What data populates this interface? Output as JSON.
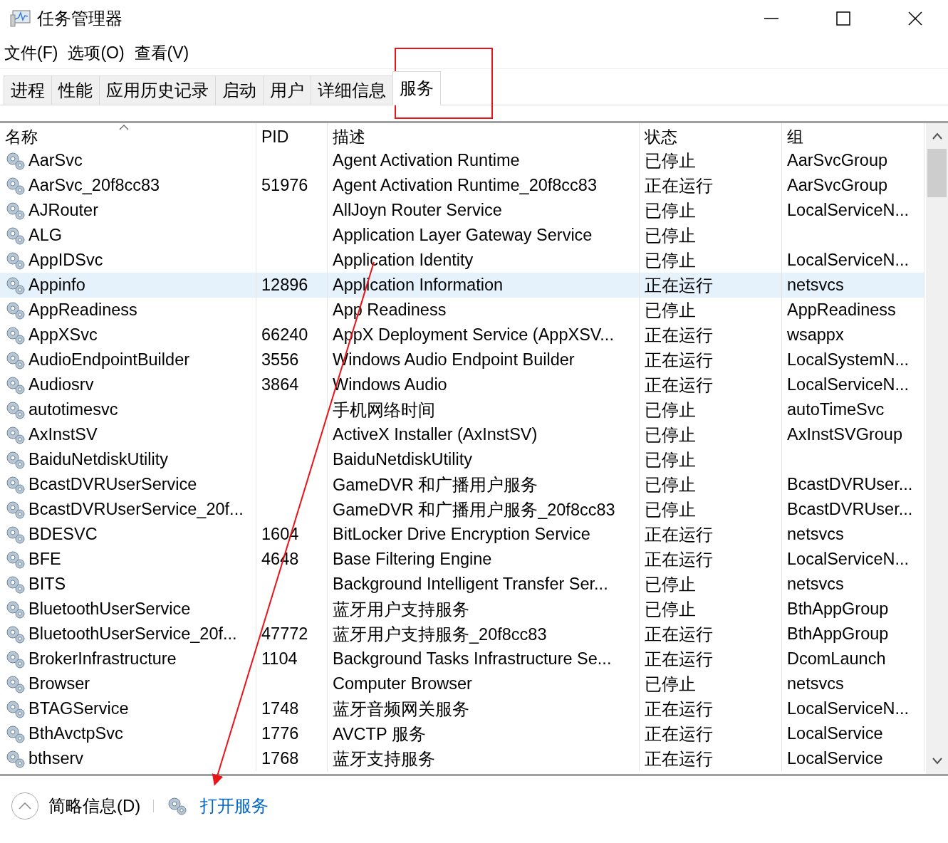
{
  "window": {
    "title": "任务管理器"
  },
  "menu": [
    "文件(F)",
    "选项(O)",
    "查看(V)"
  ],
  "tabs": [
    {
      "label": "进程",
      "selected": false
    },
    {
      "label": "性能",
      "selected": false
    },
    {
      "label": "应用历史记录",
      "selected": false
    },
    {
      "label": "启动",
      "selected": false
    },
    {
      "label": "用户",
      "selected": false
    },
    {
      "label": "详细信息",
      "selected": false
    },
    {
      "label": "服务",
      "selected": true
    }
  ],
  "table": {
    "columns": [
      {
        "label": "名称",
        "sorted": true
      },
      {
        "label": "PID",
        "sorted": false
      },
      {
        "label": "描述",
        "sorted": false
      },
      {
        "label": "状态",
        "sorted": false
      },
      {
        "label": "组",
        "sorted": false
      }
    ],
    "rows": [
      {
        "name": "AarSvc",
        "pid": "",
        "description": "Agent Activation Runtime",
        "status": "已停止",
        "group": "AarSvcGroup",
        "selected": false
      },
      {
        "name": "AarSvc_20f8cc83",
        "pid": "51976",
        "description": "Agent Activation Runtime_20f8cc83",
        "status": "正在运行",
        "group": "AarSvcGroup",
        "selected": false
      },
      {
        "name": "AJRouter",
        "pid": "",
        "description": "AllJoyn Router Service",
        "status": "已停止",
        "group": "LocalServiceN...",
        "selected": false
      },
      {
        "name": "ALG",
        "pid": "",
        "description": "Application Layer Gateway Service",
        "status": "已停止",
        "group": "",
        "selected": false
      },
      {
        "name": "AppIDSvc",
        "pid": "",
        "description": "Application Identity",
        "status": "已停止",
        "group": "LocalServiceN...",
        "selected": false
      },
      {
        "name": "Appinfo",
        "pid": "12896",
        "description": "Application Information",
        "status": "正在运行",
        "group": "netsvcs",
        "selected": true
      },
      {
        "name": "AppReadiness",
        "pid": "",
        "description": "App Readiness",
        "status": "已停止",
        "group": "AppReadiness",
        "selected": false
      },
      {
        "name": "AppXSvc",
        "pid": "66240",
        "description": "AppX Deployment Service (AppXSV...",
        "status": "正在运行",
        "group": "wsappx",
        "selected": false
      },
      {
        "name": "AudioEndpointBuilder",
        "pid": "3556",
        "description": "Windows Audio Endpoint Builder",
        "status": "正在运行",
        "group": "LocalSystemN...",
        "selected": false
      },
      {
        "name": "Audiosrv",
        "pid": "3864",
        "description": "Windows Audio",
        "status": "正在运行",
        "group": "LocalServiceN...",
        "selected": false
      },
      {
        "name": "autotimesvc",
        "pid": "",
        "description": "手机网络时间",
        "status": "已停止",
        "group": "autoTimeSvc",
        "selected": false
      },
      {
        "name": "AxInstSV",
        "pid": "",
        "description": "ActiveX Installer (AxInstSV)",
        "status": "已停止",
        "group": "AxInstSVGroup",
        "selected": false
      },
      {
        "name": "BaiduNetdiskUtility",
        "pid": "",
        "description": "BaiduNetdiskUtility",
        "status": "已停止",
        "group": "",
        "selected": false
      },
      {
        "name": "BcastDVRUserService",
        "pid": "",
        "description": "GameDVR 和广播用户服务",
        "status": "已停止",
        "group": "BcastDVRUser...",
        "selected": false
      },
      {
        "name": "BcastDVRUserService_20f...",
        "pid": "",
        "description": "GameDVR 和广播用户服务_20f8cc83",
        "status": "已停止",
        "group": "BcastDVRUser...",
        "selected": false
      },
      {
        "name": "BDESVC",
        "pid": "1604",
        "description": "BitLocker Drive Encryption Service",
        "status": "正在运行",
        "group": "netsvcs",
        "selected": false
      },
      {
        "name": "BFE",
        "pid": "4648",
        "description": "Base Filtering Engine",
        "status": "正在运行",
        "group": "LocalServiceN...",
        "selected": false
      },
      {
        "name": "BITS",
        "pid": "",
        "description": "Background Intelligent Transfer Ser...",
        "status": "已停止",
        "group": "netsvcs",
        "selected": false
      },
      {
        "name": "BluetoothUserService",
        "pid": "",
        "description": "蓝牙用户支持服务",
        "status": "已停止",
        "group": "BthAppGroup",
        "selected": false
      },
      {
        "name": "BluetoothUserService_20f...",
        "pid": "47772",
        "description": "蓝牙用户支持服务_20f8cc83",
        "status": "正在运行",
        "group": "BthAppGroup",
        "selected": false
      },
      {
        "name": "BrokerInfrastructure",
        "pid": "1104",
        "description": "Background Tasks Infrastructure Se...",
        "status": "正在运行",
        "group": "DcomLaunch",
        "selected": false
      },
      {
        "name": "Browser",
        "pid": "",
        "description": "Computer Browser",
        "status": "已停止",
        "group": "netsvcs",
        "selected": false
      },
      {
        "name": "BTAGService",
        "pid": "1748",
        "description": "蓝牙音频网关服务",
        "status": "正在运行",
        "group": "LocalServiceN...",
        "selected": false
      },
      {
        "name": "BthAvctpSvc",
        "pid": "1776",
        "description": "AVCTP 服务",
        "status": "正在运行",
        "group": "LocalService",
        "selected": false
      },
      {
        "name": "bthserv",
        "pid": "1768",
        "description": "蓝牙支持服务",
        "status": "正在运行",
        "group": "LocalService",
        "selected": false
      }
    ]
  },
  "footer": {
    "fewer_details": "简略信息(D)",
    "open_services": "打开服务"
  }
}
